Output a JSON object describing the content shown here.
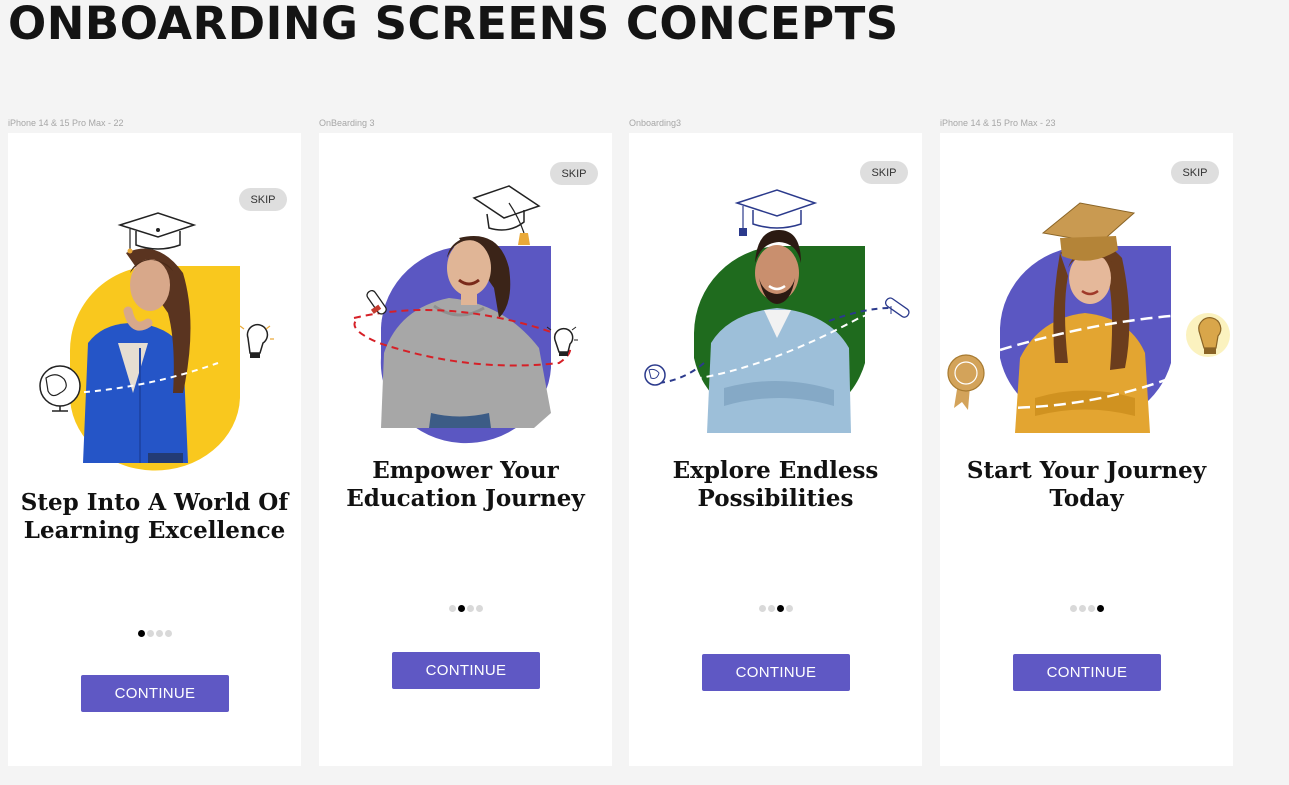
{
  "page": {
    "title": "ONBOARDING SCREENS CONCEPTS"
  },
  "colors": {
    "background": "#f4f4f4",
    "screen": "#ffffff",
    "button": "#5f58c4",
    "skip_pill": "#dedede",
    "dot_active": "#000000",
    "dot_inactive": "#d9d9d9"
  },
  "screens": [
    {
      "frame_label": "iPhone 14 & 15 Pro Max - 22",
      "skip_label": "SKIP",
      "heading_line1": "Step Into A World Of",
      "heading_line2": "Learning Excellence",
      "active_dot": 1,
      "dot_count": 4,
      "button_label": "CONTINUE",
      "shape_color": "#f9c81e",
      "person": "woman-thinking",
      "icons": [
        "graduation-cap-icon",
        "globe-icon",
        "lightbulb-icon"
      ]
    },
    {
      "frame_label": "OnBearding 3",
      "skip_label": "SKIP",
      "heading_line1": "Empower Your",
      "heading_line2": "Education Journey",
      "active_dot": 2,
      "dot_count": 4,
      "button_label": "CONTINUE",
      "shape_color": "#5b57c2",
      "person": "woman-laughing",
      "icons": [
        "graduation-cap-icon",
        "diploma-icon",
        "lightbulb-icon"
      ]
    },
    {
      "frame_label": "Onboarding3",
      "skip_label": "SKIP",
      "heading_line1": "Explore Endless",
      "heading_line2": "Possibilities",
      "active_dot": 3,
      "dot_count": 4,
      "button_label": "CONTINUE",
      "shape_color": "#1f6b1e",
      "person": "man-smiling",
      "icons": [
        "graduation-cap-icon",
        "globe-icon",
        "diploma-icon"
      ]
    },
    {
      "frame_label": "iPhone 14 & 15 Pro Max - 23",
      "skip_label": "SKIP",
      "heading_line1": "Start Your Journey",
      "heading_line2": "Today",
      "active_dot": 4,
      "dot_count": 4,
      "button_label": "CONTINUE",
      "shape_color": "#5b57c2",
      "person": "girl-smiling",
      "icons": [
        "graduation-cap-icon",
        "award-medal-icon",
        "lightbulb-icon"
      ]
    }
  ]
}
